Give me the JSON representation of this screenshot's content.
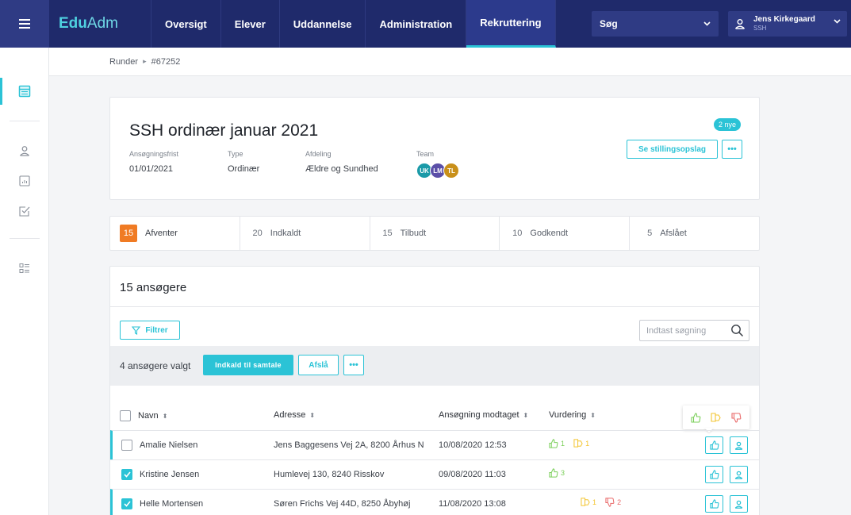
{
  "brand": {
    "part1": "Edu",
    "part2": "Adm"
  },
  "nav": {
    "tabs": [
      {
        "label": "Oversigt"
      },
      {
        "label": "Elever"
      },
      {
        "label": "Uddannelse"
      },
      {
        "label": "Administration"
      },
      {
        "label": "Rekruttering",
        "active": true
      }
    ]
  },
  "search_select": {
    "label": "Søg"
  },
  "user": {
    "name": "Jens Kirkegaard",
    "org": "SSH"
  },
  "breadcrumb": {
    "root": "Runder",
    "current": "#67252"
  },
  "round": {
    "title": "SSH ordinær januar 2021",
    "new_badge": "2 nye",
    "view_posting_label": "Se stillingsopslag",
    "more_label": "•••",
    "meta": {
      "deadline_label": "Ansøgningsfrist",
      "deadline_value": "01/01/2021",
      "type_label": "Type",
      "type_value": "Ordinær",
      "department_label": "Afdeling",
      "department_value": "Ældre og Sundhed",
      "team_label": "Team"
    },
    "team": [
      {
        "initials": "UK",
        "color": "#1a9aa8"
      },
      {
        "initials": "LM",
        "color": "#5b4fa8"
      },
      {
        "initials": "TL",
        "color": "#c9901a"
      }
    ]
  },
  "status_tabs": [
    {
      "count": "15",
      "label": "Afventer",
      "active": true
    },
    {
      "count": "20",
      "label": "Indkaldt"
    },
    {
      "count": "15",
      "label": "Tilbudt"
    },
    {
      "count": "10",
      "label": "Godkendt"
    },
    {
      "count": "5",
      "label": "Afslået"
    }
  ],
  "applicants": {
    "heading": "15 ansøgere",
    "filter_label": "Filtrer",
    "search_placeholder": "Indtast søgning",
    "selected_label": "4 ansøgere valgt",
    "invite_label": "Indkald til samtale",
    "reject_label": "Afslå",
    "more_label": "•••",
    "columns": {
      "name": "Navn",
      "address": "Adresse",
      "received": "Ansøgning modtaget",
      "rating": "Vurdering"
    },
    "rows": [
      {
        "name": "Amalie Nielsen",
        "address": "Jens Baggesens Vej 2A, 8200 Århus N",
        "received": "10/08/2020 12:53",
        "up": "1",
        "mid": "1",
        "down": "",
        "checked": false,
        "marked": true
      },
      {
        "name": "Kristine Jensen",
        "address": "Humlevej 130, 8240 Risskov",
        "received": "09/08/2020 11:03",
        "up": "3",
        "mid": "",
        "down": "",
        "checked": true,
        "marked": false
      },
      {
        "name": "Helle Mortensen",
        "address": "Søren Frichs Vej 44D, 8250 Åbyhøj",
        "received": "11/08/2020 13:08",
        "up": "",
        "mid": "1",
        "down": "2",
        "checked": true,
        "marked": true
      }
    ]
  },
  "colors": {
    "nav_bg": "#1f2a6b",
    "accent": "#2bc3d6",
    "orange": "#f07b24",
    "up": "#7bcf5a",
    "mid": "#f3c531",
    "down": "#e96a6a"
  }
}
